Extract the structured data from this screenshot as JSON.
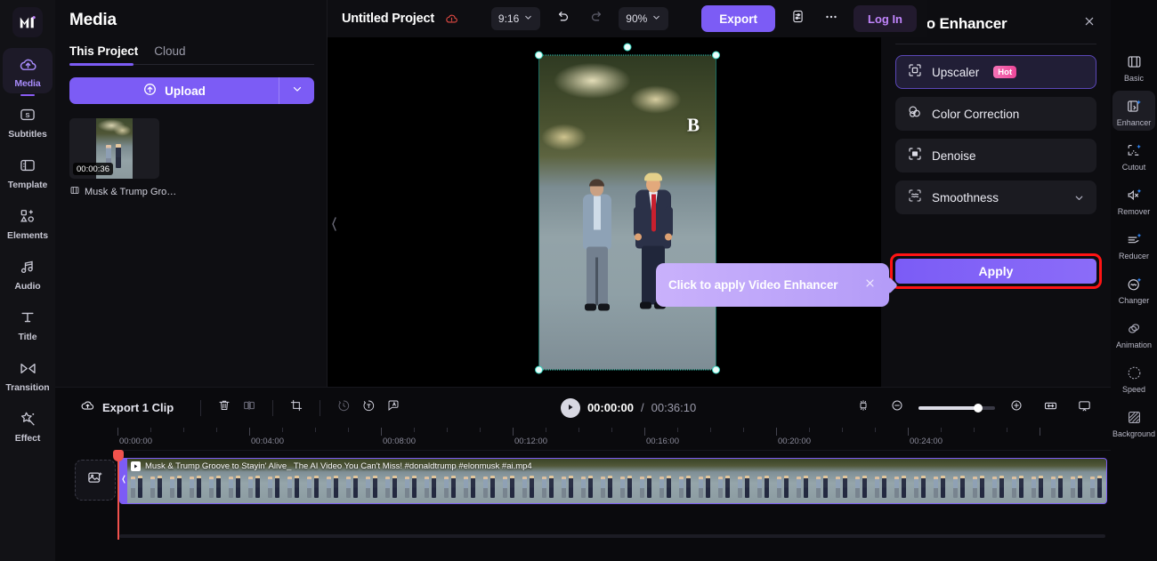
{
  "app": {
    "logo_alt": "media-io-logo"
  },
  "left_rail": {
    "items": [
      {
        "label": "Media",
        "icon": "cloud-upload-icon",
        "active": true
      },
      {
        "label": "Subtitles",
        "icon": "subtitle-s-icon",
        "active": false
      },
      {
        "label": "Template",
        "icon": "template-icon",
        "active": false
      },
      {
        "label": "Elements",
        "icon": "elements-shapes-icon",
        "active": false
      },
      {
        "label": "Audio",
        "icon": "music-note-icon",
        "active": false
      },
      {
        "label": "Title",
        "icon": "text-t-icon",
        "active": false
      },
      {
        "label": "Transition",
        "icon": "transition-bowtie-icon",
        "active": false
      },
      {
        "label": "Effect",
        "icon": "magic-star-icon",
        "active": false
      }
    ]
  },
  "media_panel": {
    "title": "Media",
    "tabs": [
      {
        "label": "This Project",
        "active": true
      },
      {
        "label": "Cloud",
        "active": false
      }
    ],
    "upload_label": "Upload",
    "upload_icon": "cloud-upload-icon",
    "upload_dropdown_icon": "chevron-down-icon",
    "items": [
      {
        "duration": "00:00:36",
        "name": "Musk & Trump Gro…",
        "type_icon": "film-clip-icon"
      }
    ]
  },
  "topbar": {
    "project_title": "Untitled Project",
    "warning_icon": "unsaved-cloud-warning-icon",
    "aspect_ratio": "9:16",
    "undo_icon": "undo-arrow-icon",
    "redo_icon": "redo-arrow-icon",
    "zoom_level": "90%",
    "export_label": "Export",
    "settings_icon": "export-settings-icon",
    "more_icon": "more-dots-icon",
    "login_label": "Log In"
  },
  "preview": {
    "watermark": "B",
    "collapse_icon": "chevron-left-icon",
    "selection": "video-clip-selected"
  },
  "callout": {
    "text": "Click to apply Video Enhancer",
    "close_icon": "close-x-icon",
    "bg_color": "#b49cf8"
  },
  "right_panel": {
    "title": "Video Enhancer",
    "close_icon": "close-x-icon",
    "features": [
      {
        "label": "Upscaler",
        "icon": "upscale-frame-icon",
        "badge": "Hot",
        "selected": true,
        "chevron": false
      },
      {
        "label": "Color Correction",
        "icon": "color-circles-icon",
        "badge": "",
        "selected": false,
        "chevron": false
      },
      {
        "label": "Denoise",
        "icon": "denoise-icon",
        "badge": "",
        "selected": false,
        "chevron": false
      },
      {
        "label": "Smoothness",
        "icon": "smoothness-waves-icon",
        "badge": "",
        "selected": false,
        "chevron": true
      }
    ],
    "apply_label": "Apply",
    "apply_highlight_color": "#ff1414"
  },
  "right_rail": {
    "items": [
      {
        "label": "Basic",
        "icon": "film-basic-icon",
        "active": false
      },
      {
        "label": "Enhancer",
        "icon": "ai-enhancer-icon",
        "active": true
      },
      {
        "label": "Cutout",
        "icon": "ai-cutout-icon",
        "active": false
      },
      {
        "label": "Remover",
        "icon": "ai-noise-remover-icon",
        "active": false
      },
      {
        "label": "Reducer",
        "icon": "ai-reducer-icon",
        "active": false
      },
      {
        "label": "Changer",
        "icon": "ai-voice-changer-icon",
        "active": false
      },
      {
        "label": "Animation",
        "icon": "animation-icon",
        "active": false
      },
      {
        "label": "Speed",
        "icon": "speedometer-icon",
        "active": false
      },
      {
        "label": "Background",
        "icon": "background-pattern-icon",
        "active": false
      }
    ]
  },
  "timeline": {
    "export_clip_label": "Export 1 Clip",
    "export_clip_icon": "cloud-upload-icon",
    "tools": [
      {
        "name": "delete-icon"
      },
      {
        "name": "split-icon"
      },
      {
        "name": "crop-icon"
      },
      {
        "name": "speed-icon"
      },
      {
        "name": "text-to-speech-icon"
      },
      {
        "name": "auto-caption-icon"
      }
    ],
    "play_icon": "play-triangle-icon",
    "current_time": "00:00:00",
    "separator": "/",
    "total_time": "00:36:10",
    "right_tools": [
      {
        "name": "snap-magnet-icon"
      },
      {
        "name": "zoom-out-icon"
      },
      {
        "name": "zoom-in-icon"
      },
      {
        "name": "fit-to-screen-icon"
      },
      {
        "name": "preview-render-icon"
      }
    ],
    "zoom_value": "72",
    "ruler_labels": [
      "00:00:00",
      "00:04:00",
      "00:08:00",
      "00:12:00",
      "00:16:00",
      "00:20:00",
      "00:24:00"
    ],
    "add_track_icon": "add-image-track-icon",
    "clip": {
      "title": "Musk & Trump Groove to Stayin' Alive_ The AI Video You Can't Miss! #donaldtrump #elonmusk #ai.mp4",
      "play_icon": "play-triangle-icon",
      "handle_icon": "chevron-left-icon"
    }
  }
}
